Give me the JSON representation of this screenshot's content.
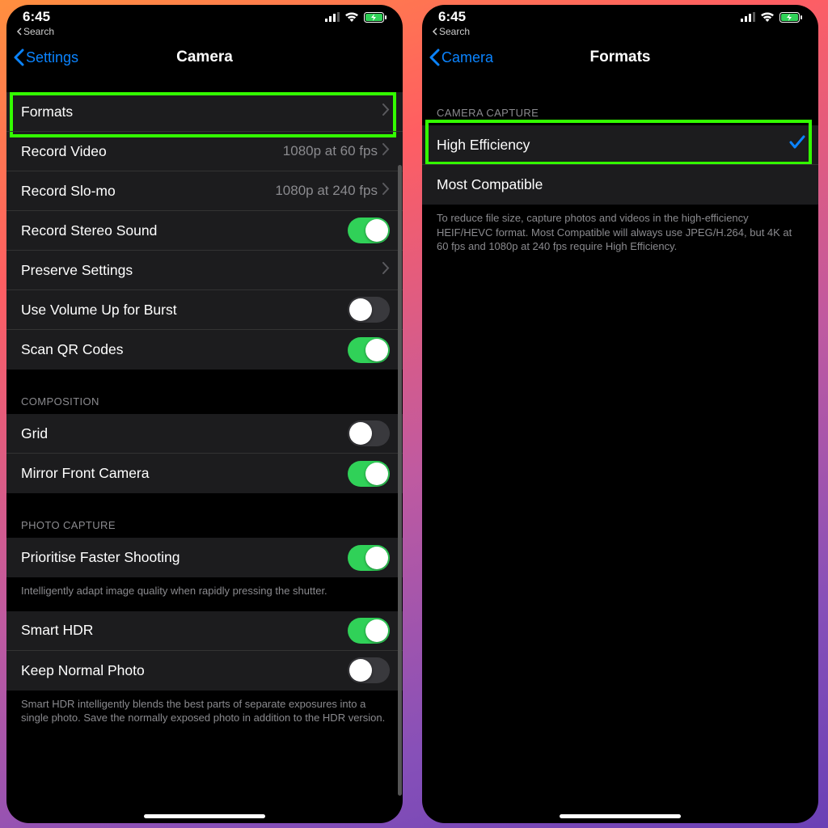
{
  "status": {
    "time": "6:45"
  },
  "breadcrumb": "Search",
  "left": {
    "back": "Settings",
    "title": "Camera",
    "rows": {
      "formats": "Formats",
      "recordVideo": {
        "label": "Record Video",
        "value": "1080p at 60 fps"
      },
      "recordSlomo": {
        "label": "Record Slo-mo",
        "value": "1080p at 240 fps"
      },
      "stereo": "Record Stereo Sound",
      "preserve": "Preserve Settings",
      "volumeBurst": "Use Volume Up for Burst",
      "scanQR": "Scan QR Codes"
    },
    "compositionHeader": "Composition",
    "composition": {
      "grid": "Grid",
      "mirror": "Mirror Front Camera"
    },
    "photoHeader": "Photo Capture",
    "photo": {
      "prioritise": "Prioritise Faster Shooting",
      "prioritiseFooter": "Intelligently adapt image quality when rapidly pressing the shutter.",
      "smartHDR": "Smart HDR",
      "keepNormal": "Keep Normal Photo",
      "hdrFooter": "Smart HDR intelligently blends the best parts of separate exposures into a single photo. Save the normally exposed photo in addition to the HDR version."
    }
  },
  "right": {
    "back": "Camera",
    "title": "Formats",
    "header": "Camera Capture",
    "options": {
      "highEff": "High Efficiency",
      "mostComp": "Most Compatible"
    },
    "footer": "To reduce file size, capture photos and videos in the high-efficiency HEIF/HEVC format. Most Compatible will always use JPEG/H.264, but 4K at 60 fps and 1080p at 240 fps require High Efficiency."
  }
}
